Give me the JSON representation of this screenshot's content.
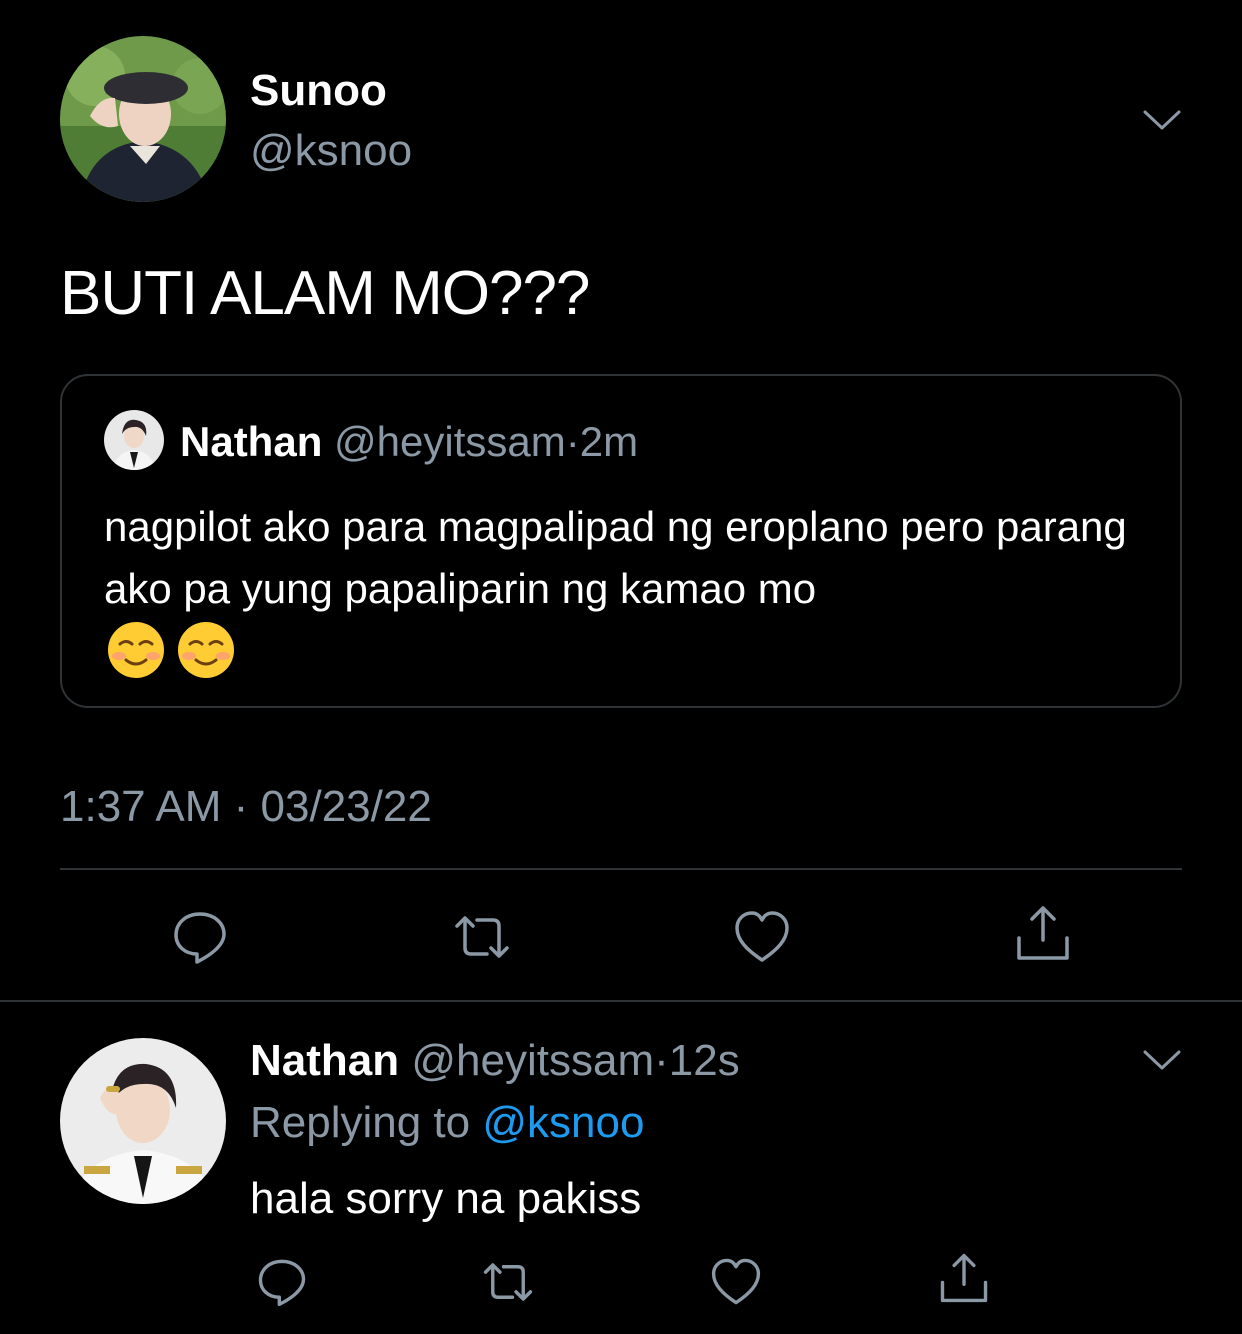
{
  "main_tweet": {
    "author": {
      "name": "Sunoo",
      "handle": "@ksnoo"
    },
    "text": "BUTI ALAM MO???",
    "quoted_tweet": {
      "author_name": "Nathan",
      "author_handle": "@heyitssam",
      "separator": "·",
      "time": "2m",
      "text": "nagpilot ako para magpalipad ng eroplano pero parang ako pa yung papaliparin ng kamao mo",
      "emojis": [
        "smiling-face-emoji",
        "smiling-face-emoji"
      ]
    },
    "timestamp": "1:37 AM · 03/23/22",
    "actions": [
      "reply-icon",
      "retweet-icon",
      "like-icon",
      "share-icon"
    ]
  },
  "reply": {
    "author_name": "Nathan",
    "author_handle": "@heyitssam",
    "separator": "·",
    "time": "12s",
    "replying_prefix": "Replying to",
    "replying_to": "@ksnoo",
    "text": "hala sorry na pakiss",
    "actions": [
      "reply-icon",
      "retweet-icon",
      "like-icon",
      "share-icon"
    ]
  },
  "colors": {
    "background": "#000000",
    "primary_text": "#ffffff",
    "secondary_text": "#8b98a5",
    "border": "#2f3336",
    "accent": "#1d9bf0"
  }
}
